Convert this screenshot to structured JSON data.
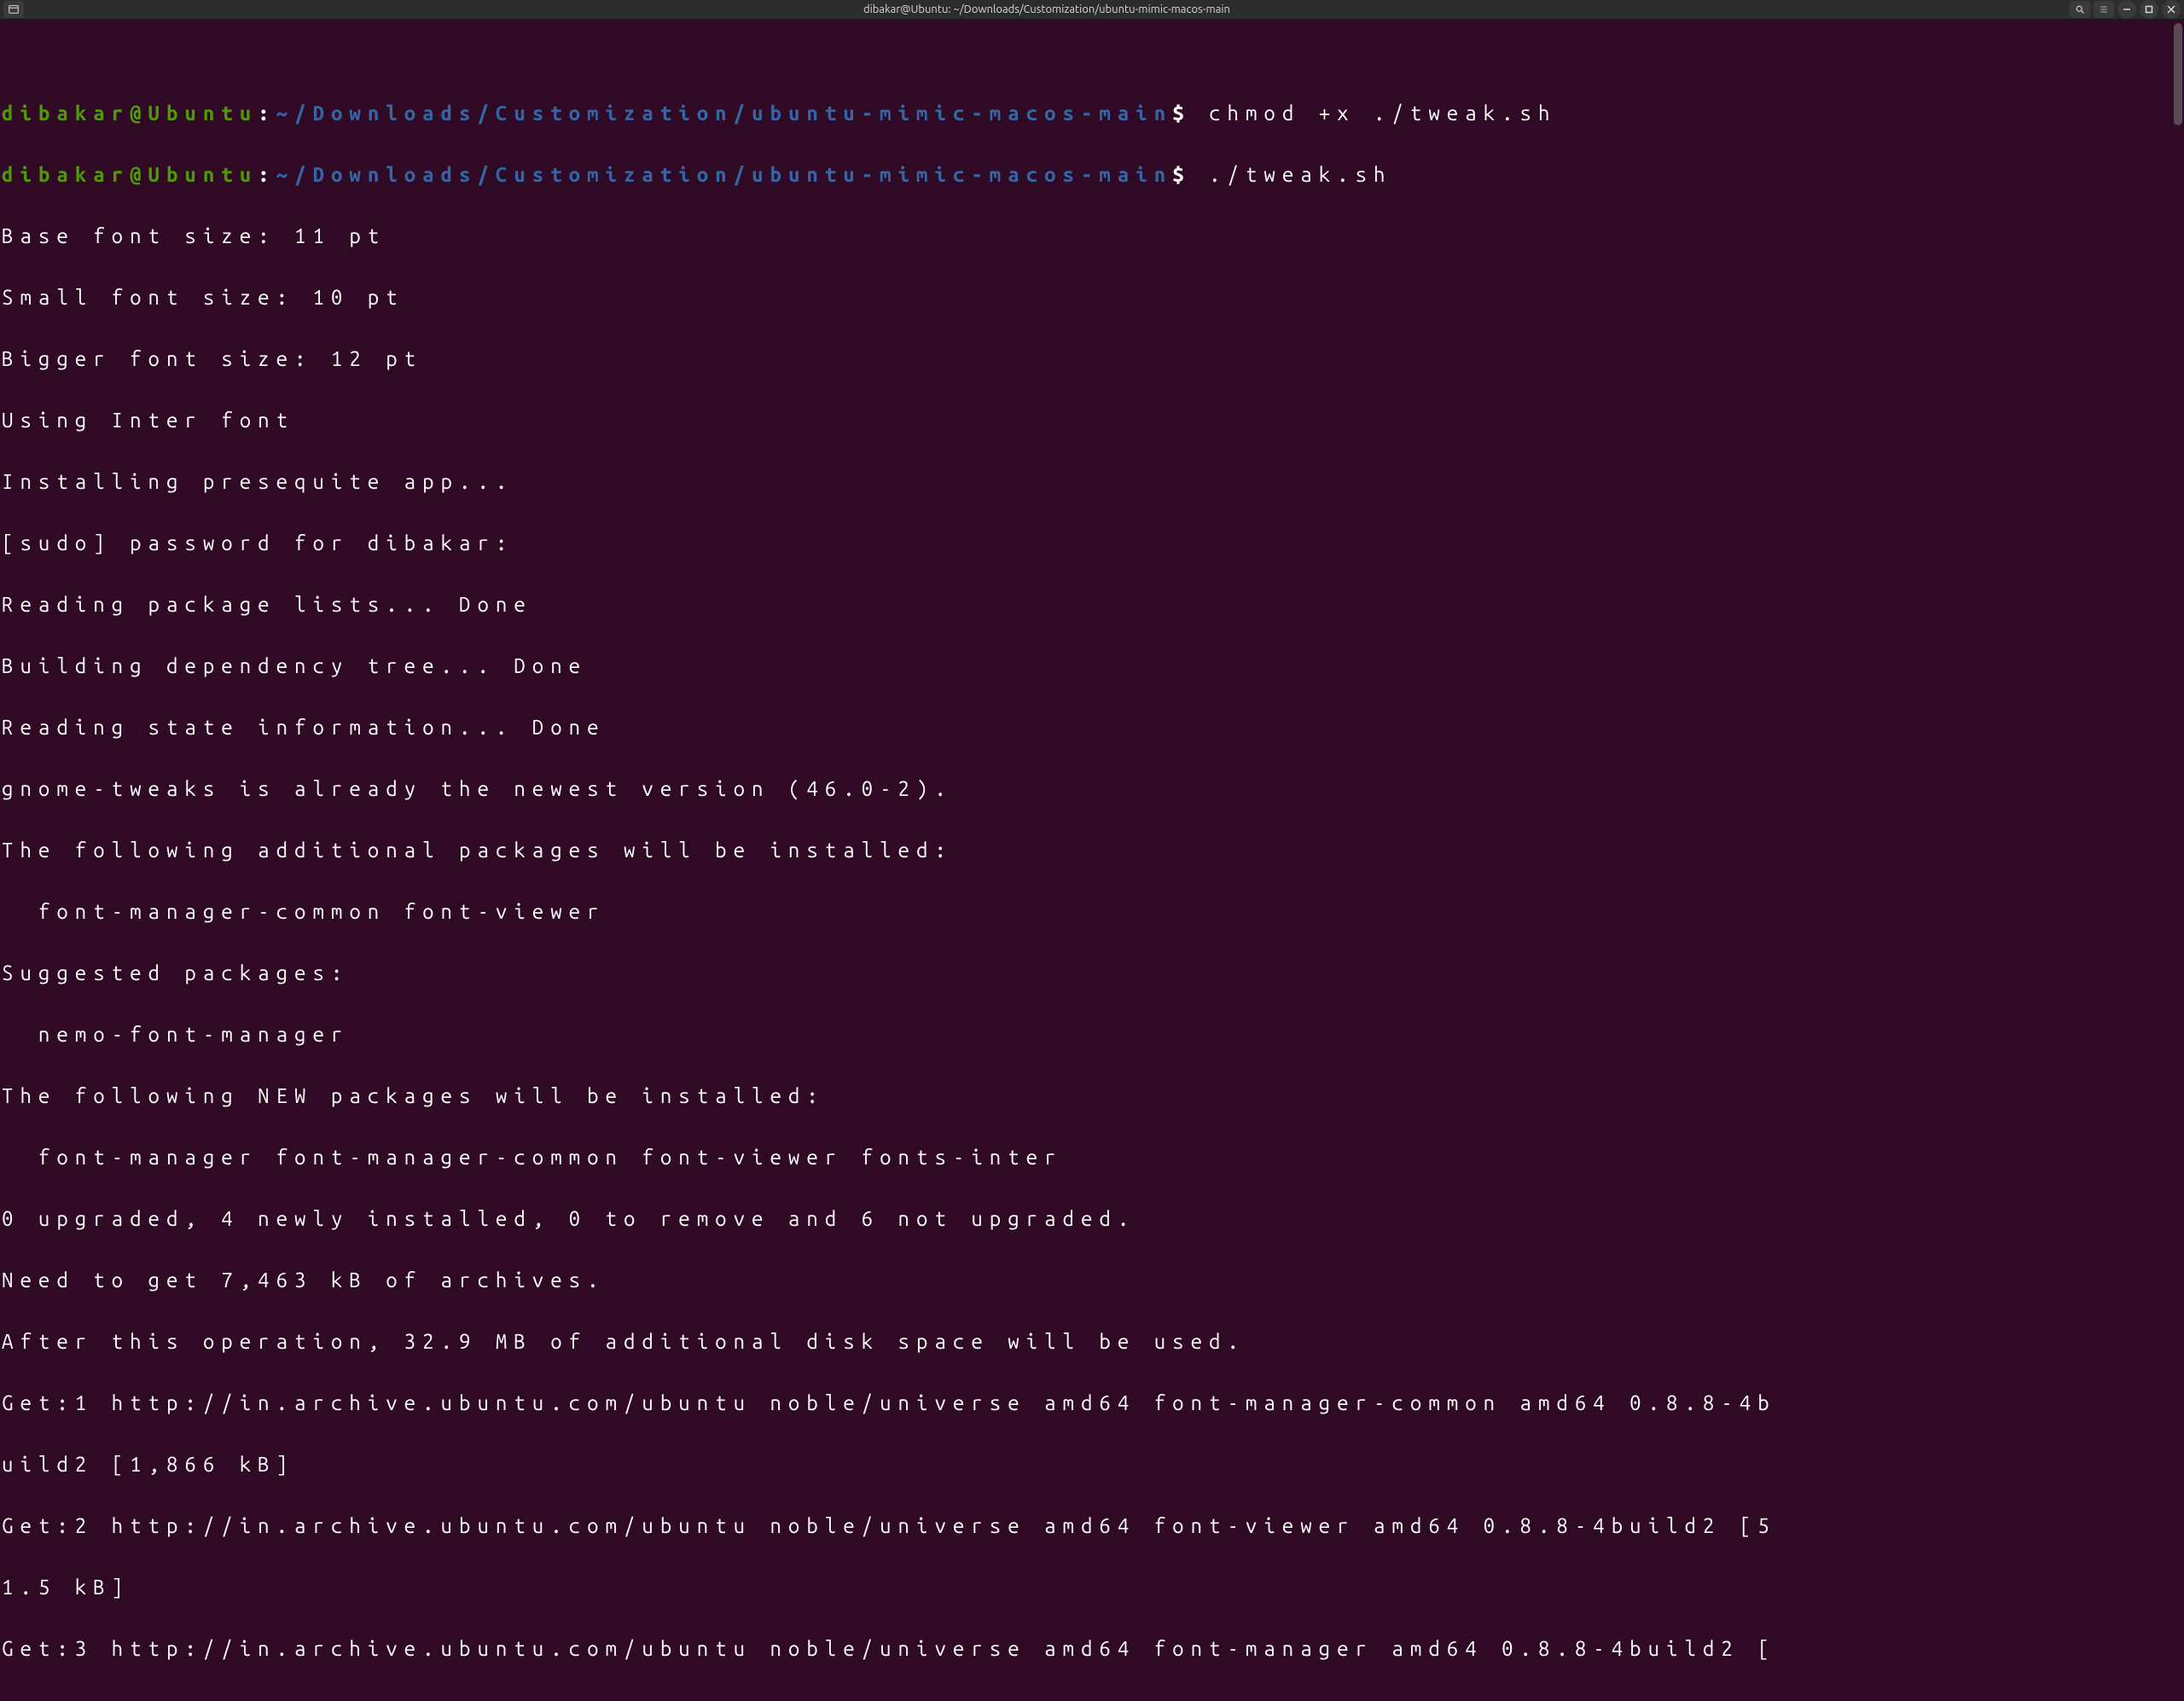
{
  "titlebar": {
    "title": "dibakar@Ubuntu: ~/Downloads/Customization/ubuntu-mimic-macos-main"
  },
  "prompt": {
    "user_host": "dibakar@Ubuntu",
    "colon": ":",
    "path": "~/Downloads/Customization/ubuntu-mimic-macos-main",
    "dollar": "$"
  },
  "commands": {
    "cmd0": " chmod +x ./tweak.sh",
    "cmd1": " ./tweak.sh"
  },
  "out": {
    "l0": "Base font size: 11 pt",
    "l1": "Small font size: 10 pt",
    "l2": "Bigger font size: 12 pt",
    "l3": "Using Inter font",
    "l4": "Installing presequite app...",
    "l5": "[sudo] password for dibakar:",
    "l6": "Reading package lists... Done",
    "l7": "Building dependency tree... Done",
    "l8": "Reading state information... Done",
    "l9": "gnome-tweaks is already the newest version (46.0-2).",
    "l10": "The following additional packages will be installed:",
    "l11": "  font-manager-common font-viewer",
    "l12": "Suggested packages:",
    "l13": "  nemo-font-manager",
    "l14": "The following NEW packages will be installed:",
    "l15": "  font-manager font-manager-common font-viewer fonts-inter",
    "l16": "0 upgraded, 4 newly installed, 0 to remove and 6 not upgraded.",
    "l17": "Need to get 7,463 kB of archives.",
    "l18": "After this operation, 32.9 MB of additional disk space will be used.",
    "l19": "Get:1 http://in.archive.ubuntu.com/ubuntu noble/universe amd64 font-manager-common amd64 0.8.8-4b",
    "l20": "uild2 [1,866 kB]",
    "l21": "Get:2 http://in.archive.ubuntu.com/ubuntu noble/universe amd64 font-viewer amd64 0.8.8-4build2 [5",
    "l22": "1.5 kB]",
    "l23": "Get:3 http://in.archive.ubuntu.com/ubuntu noble/universe amd64 font-manager amd64 0.8.8-4build2 ["
  }
}
